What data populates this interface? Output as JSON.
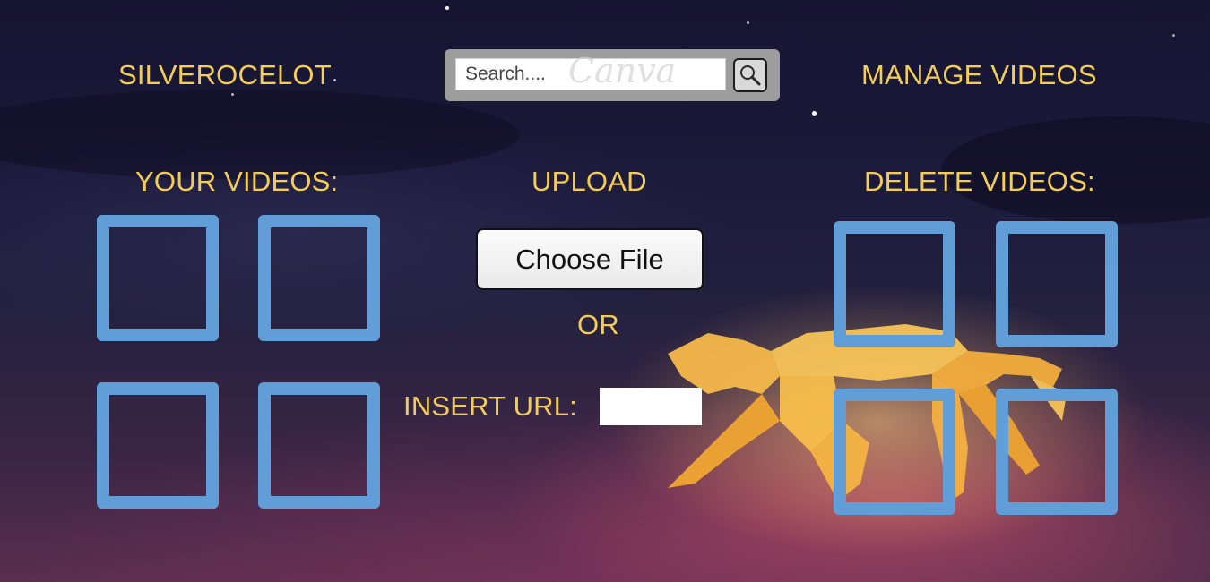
{
  "brand": "SILVEROCELOT",
  "nav": {
    "manage_videos": "MANAGE VIDEOS"
  },
  "search": {
    "placeholder": "Search....",
    "watermark": "Canva",
    "button_icon": "magnifier-icon"
  },
  "sections": {
    "your_videos": "YOUR VIDEOS:",
    "upload": "UPLOAD",
    "delete_videos": "DELETE VIDEOS:"
  },
  "upload": {
    "choose_file_label": "Choose File",
    "or_label": "OR",
    "insert_url_label": "INSERT URL:",
    "url_value": ""
  },
  "colors": {
    "accent_text": "#f5cd54",
    "slot_border": "#619ed8"
  }
}
